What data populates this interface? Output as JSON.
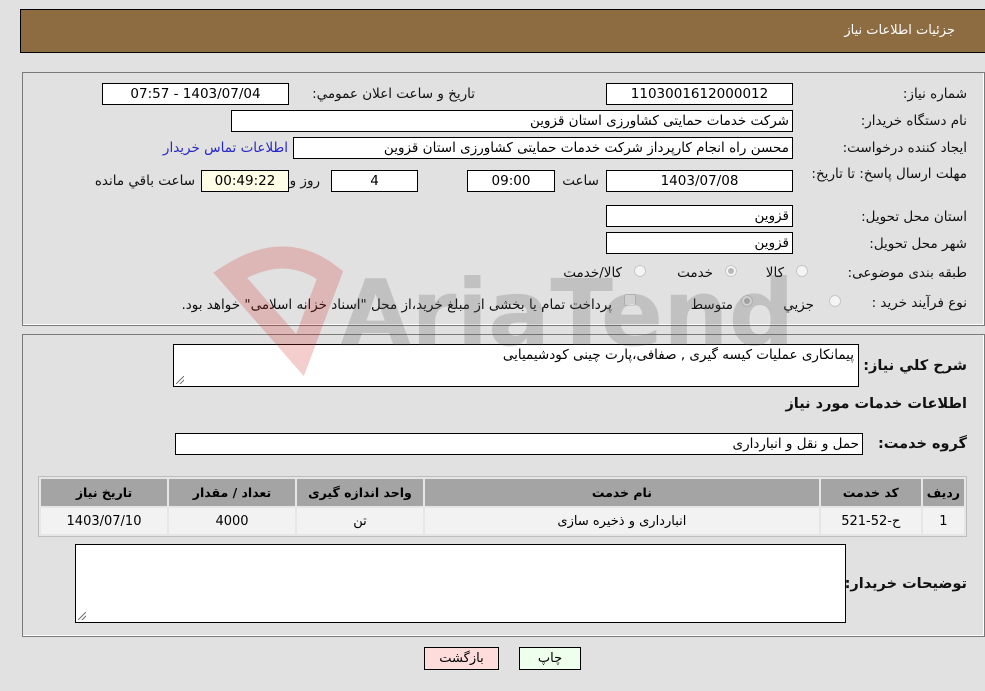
{
  "header": {
    "title": "جزئیات اطلاعات نیاز"
  },
  "fields": {
    "need_number": {
      "label": "شماره نیاز:",
      "value": "1103001612000012"
    },
    "announce_datetime": {
      "label": "تاریخ و ساعت اعلان عمومي:",
      "value": "1403/07/04 - 07:57"
    },
    "buyer_org": {
      "label": "نام دستگاه خريدار:",
      "value": "شرکت خدمات حمایتی کشاورزی استان قزوین"
    },
    "requester": {
      "label": "ایجاد کننده درخواست:",
      "value": "محسن راه انجام کارپرداز شرکت خدمات حمایتی کشاورزی استان قزوین"
    },
    "buyer_contact_link": "اطلاعات تماس خریدار",
    "deadline": {
      "label": "مهلت ارسال پاسخ: تا تاریخ:",
      "date": "1403/07/08",
      "time_label": "ساعت",
      "time": "09:00",
      "days": "4",
      "days_label": "روز و",
      "remaining": "00:49:22",
      "remaining_label": "ساعت باقي مانده"
    },
    "delivery_province": {
      "label": "استان محل تحویل:",
      "value": "قزوین"
    },
    "delivery_city": {
      "label": "شهر محل تحویل:",
      "value": "قزوین"
    },
    "category": {
      "label": "طبقه بندی موضوعی:",
      "options": [
        "کالا",
        "خدمت",
        "کالا/خدمت"
      ],
      "selected": "خدمت"
    },
    "purchase_type": {
      "label": "نوع فرآیند خرید :",
      "options": [
        "جزيي",
        "متوسط"
      ],
      "selected": "متوسط",
      "treasury_note": "پرداخت تمام یا بخشی از مبلغ خرید،از محل \"اسناد خزانه اسلامی\" خواهد بود."
    }
  },
  "description": {
    "label": "شرح كلي نياز:",
    "value": "پیمانکاری عملیات کیسه گیری , صفافی،پارت چینی کودشیمیایی"
  },
  "services_section": {
    "title": "اطلاعات خدمات مورد نياز",
    "service_group_label": "گروه خدمت:",
    "service_group_value": "حمل و نقل و انبارداری"
  },
  "table": {
    "headers": [
      "رديف",
      "كد خدمت",
      "نام خدمت",
      "واحد اندازه گیری",
      "تعداد / مقدار",
      "تاریخ نیاز"
    ],
    "rows": [
      [
        "1",
        "ح-52-521",
        "انبارداری و ذخیره سازی",
        "تن",
        "4000",
        "1403/07/10"
      ]
    ]
  },
  "buyer_notes": {
    "label": "توضيحات خريدار:",
    "value": ""
  },
  "buttons": {
    "print": "چاپ",
    "back": "بازگشت"
  },
  "colors": {
    "header_bg": "#8e6c42",
    "back_bg": "#ffdcdc",
    "print_bg": "#eeffee",
    "link": "#2727c8"
  }
}
